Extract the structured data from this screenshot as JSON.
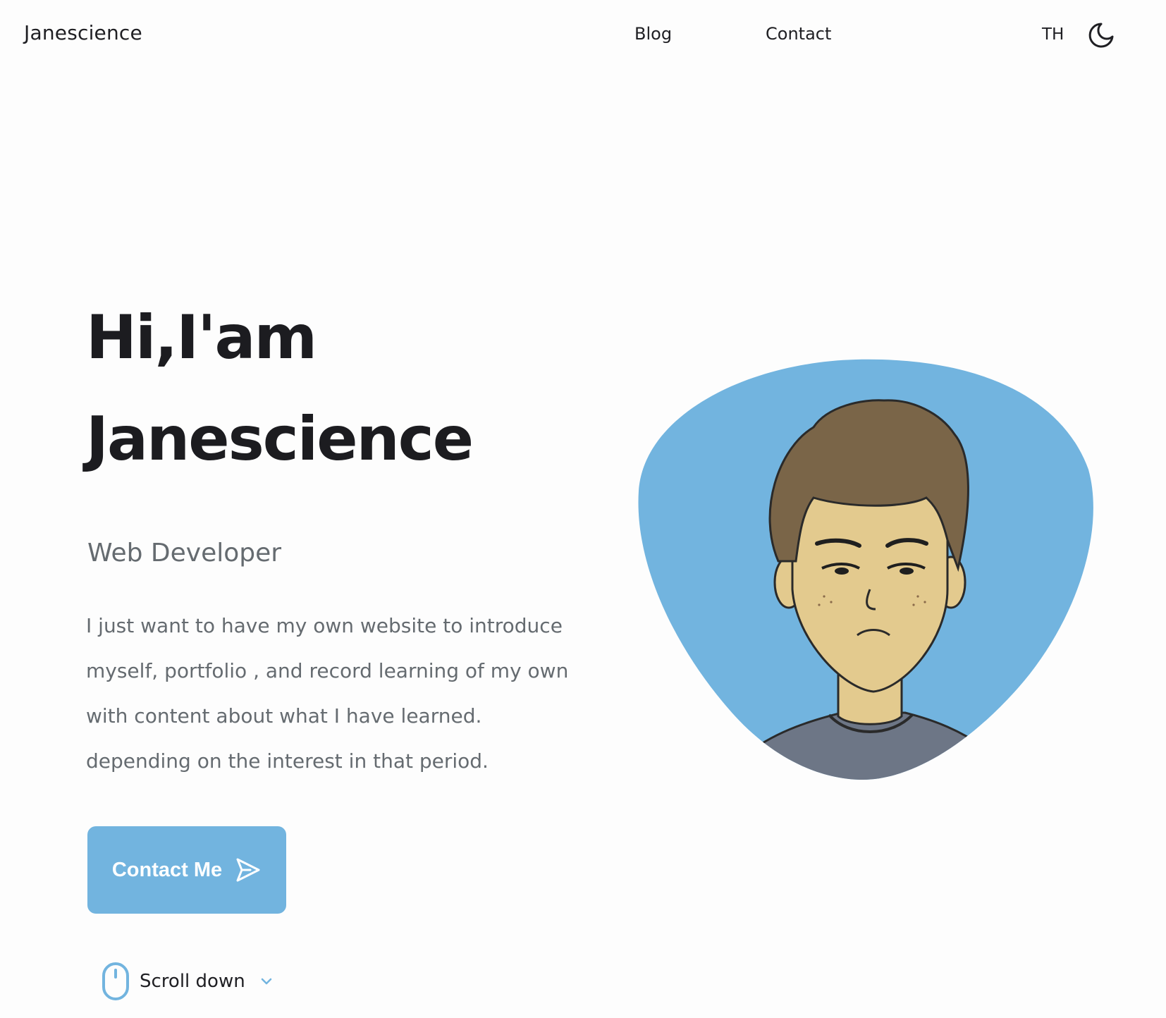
{
  "header": {
    "logo": "Janescience",
    "nav": [
      {
        "label": "Blog"
      },
      {
        "label": "Contact"
      }
    ],
    "lang": "TH",
    "theme_icon": "moon-icon"
  },
  "hero": {
    "greeting": "Hi,I'am",
    "name": "Janescience",
    "role": "Web Developer",
    "description_lines": [
      "I just want to have my own website to introduce",
      "myself, portfolio , and record learning of my own",
      "with content about what I have learned.",
      "depending on the interest in that period."
    ],
    "cta_label": "Contact Me",
    "cta_icon": "send-icon",
    "scroll_label": "Scroll down",
    "scroll_icon": "mouse-icon"
  },
  "colors": {
    "accent": "#72b4df",
    "text_dark": "#1c1c20",
    "text_muted": "#656b70",
    "background": "#fdfdfd"
  }
}
